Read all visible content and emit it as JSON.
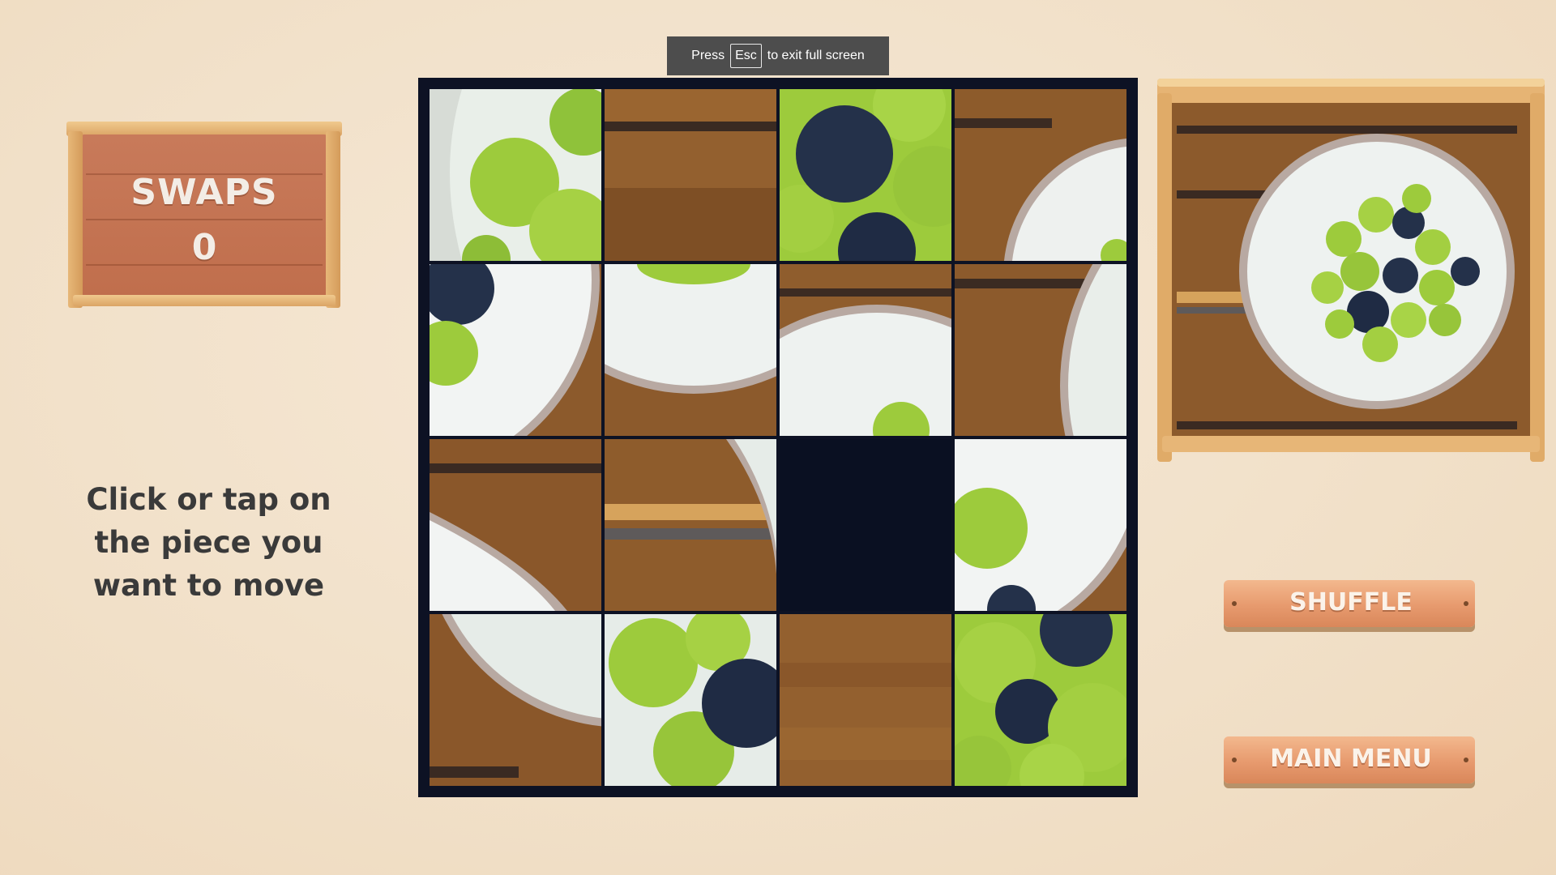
{
  "toast": {
    "press": "Press",
    "key": "Esc",
    "suffix": "to exit full screen"
  },
  "swaps": {
    "title": "SWAPS",
    "value": "0"
  },
  "instructions": {
    "text": "Click or tap on the piece you want to move"
  },
  "buttons": {
    "shuffle": "SHUFFLE",
    "main_menu": "MAIN MENU"
  },
  "puzzle": {
    "grid": "4x4",
    "empty_tile": "row 3, column 3",
    "tiles": [
      "apples-bowl-edge",
      "wood-strip",
      "blueberry-apples",
      "bowl-rim-wood",
      "blueberry-bowl",
      "bowl-inside-wood",
      "bowl-rim-apple",
      "wood-bowl-edge",
      "wood-bowl-corner",
      "wood-bowl-side",
      "empty",
      "apples-bowl-white",
      "bowl-bottom-wood",
      "apples-blueberry",
      "wood-plain",
      "apples-blueberries"
    ]
  },
  "colors": {
    "board": "#0d1224",
    "wood": "#8a5a2b",
    "apple": "#9dcb3c",
    "blueberry": "#23304a",
    "bowl": "#eef1ef"
  }
}
